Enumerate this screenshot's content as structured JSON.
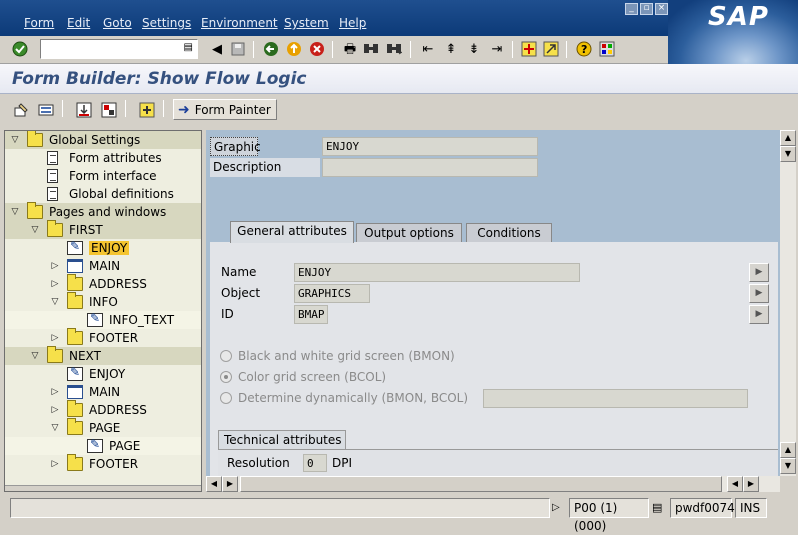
{
  "menu": [
    "Form",
    "Edit",
    "Goto",
    "Settings",
    "Environment",
    "System",
    "Help"
  ],
  "brand": "SAP",
  "window_buttons": [
    "minimize-icon",
    "restore-icon",
    "close-icon"
  ],
  "command_field": {
    "value": ""
  },
  "title": "Form Builder: Show Flow Logic",
  "app_toolbar": {
    "form_painter_label": "Form Painter"
  },
  "tree": [
    {
      "label": "Global Settings",
      "level": 0,
      "expanded": true,
      "icon": "folder-icon"
    },
    {
      "label": "Form attributes",
      "level": 1,
      "icon": "document-icon"
    },
    {
      "label": "Form interface",
      "level": 1,
      "icon": "document-icon"
    },
    {
      "label": "Global definitions",
      "level": 1,
      "icon": "document-icon"
    },
    {
      "label": "Pages and windows",
      "level": 0,
      "expanded": true,
      "icon": "folder-icon"
    },
    {
      "label": "FIRST",
      "level": 1,
      "expanded": true,
      "icon": "folder-icon"
    },
    {
      "label": "ENJOY",
      "level": 2,
      "icon": "graphic-icon",
      "selected": true
    },
    {
      "label": "MAIN",
      "level": 2,
      "expanded": false,
      "icon": "window-icon"
    },
    {
      "label": "ADDRESS",
      "level": 2,
      "expanded": false,
      "icon": "folder-icon"
    },
    {
      "label": "INFO",
      "level": 2,
      "expanded": true,
      "icon": "folder-icon"
    },
    {
      "label": "INFO_TEXT",
      "level": 3,
      "icon": "text-icon"
    },
    {
      "label": "FOOTER",
      "level": 2,
      "expanded": false,
      "icon": "folder-icon"
    },
    {
      "label": "NEXT",
      "level": 1,
      "expanded": true,
      "icon": "folder-icon"
    },
    {
      "label": "ENJOY",
      "level": 2,
      "icon": "graphic-icon"
    },
    {
      "label": "MAIN",
      "level": 2,
      "expanded": false,
      "icon": "window-icon"
    },
    {
      "label": "ADDRESS",
      "level": 2,
      "expanded": false,
      "icon": "folder-icon"
    },
    {
      "label": "PAGE",
      "level": 2,
      "expanded": true,
      "icon": "folder-icon"
    },
    {
      "label": "PAGE",
      "level": 3,
      "icon": "text-icon"
    },
    {
      "label": "FOOTER",
      "level": 2,
      "expanded": false,
      "icon": "folder-icon"
    }
  ],
  "header": {
    "graphic_label": "Graphic",
    "graphic_value": "ENJOY",
    "description_label": "Description",
    "description_value": ""
  },
  "tabs": [
    {
      "label": "General attributes",
      "active": true
    },
    {
      "label": "Output options",
      "active": false
    },
    {
      "label": "Conditions",
      "active": false
    }
  ],
  "general": {
    "name_label": "Name",
    "name_value": "ENJOY",
    "object_label": "Object",
    "object_value": "GRAPHICS",
    "id_label": "ID",
    "id_value": "BMAP"
  },
  "radios": [
    {
      "label": "Black and white grid screen (BMON)",
      "checked": false
    },
    {
      "label": "Color grid screen (BCOL)",
      "checked": true
    },
    {
      "label": "Determine dynamically (BMON, BCOL)",
      "checked": false
    }
  ],
  "technical": {
    "tab_label": "Technical attributes",
    "resolution_label": "Resolution",
    "resolution_value": "0",
    "resolution_unit": "DPI"
  },
  "status": {
    "session": "P00 (1) (000)",
    "server": "pwdf0074",
    "mode": "INS"
  }
}
